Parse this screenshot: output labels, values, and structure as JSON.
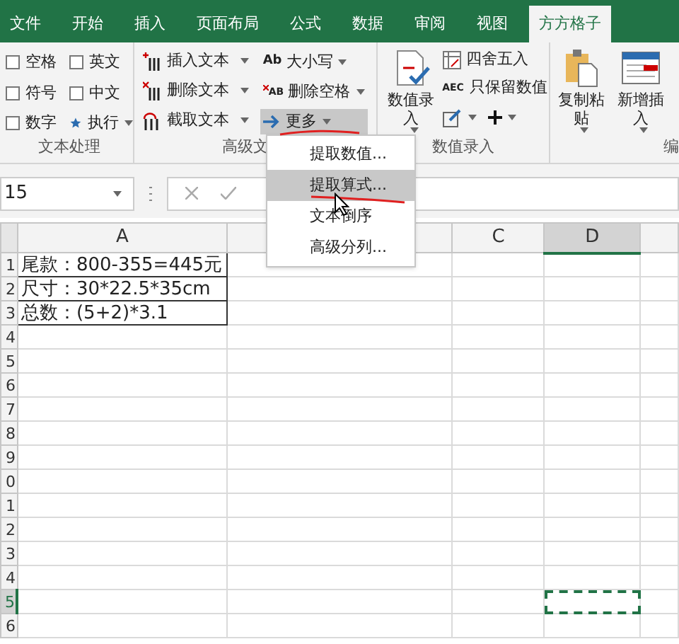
{
  "tabs": [
    {
      "label": "文件",
      "selected": false
    },
    {
      "label": "开始",
      "selected": false
    },
    {
      "label": "插入",
      "selected": false
    },
    {
      "label": "页面布局",
      "selected": false
    },
    {
      "label": "公式",
      "selected": false
    },
    {
      "label": "数据",
      "selected": false
    },
    {
      "label": "审阅",
      "selected": false
    },
    {
      "label": "视图",
      "selected": false
    },
    {
      "label": "方方格子",
      "selected": true
    }
  ],
  "text_group": {
    "label": "文本处理",
    "options": [
      {
        "label": "空格",
        "checked": false
      },
      {
        "label": "英文",
        "checked": false
      },
      {
        "label": "符号",
        "checked": false
      },
      {
        "label": "中文",
        "checked": false
      },
      {
        "label": "数字",
        "checked": false
      }
    ],
    "run_button": "执行"
  },
  "advanced_text": {
    "label": "高级文",
    "left_buttons": [
      "插入文本",
      "删除文本",
      "截取文本"
    ],
    "right_buttons": [
      {
        "label": "大小写",
        "icon_text": "Ab",
        "pressed": false
      },
      {
        "label": "删除空格",
        "icon_text": "AB",
        "pressed": false
      },
      {
        "label": "更多",
        "pressed": true
      }
    ]
  },
  "number_entry": {
    "label": "数值录入",
    "big_button": "数值录入",
    "buttons": [
      "四舍五入",
      "只保留数值"
    ],
    "icon_text": "AEC"
  },
  "edit_group": {
    "label": "编",
    "big_buttons": [
      "复制粘贴",
      "新增插入"
    ]
  },
  "name_box": "15",
  "menu": {
    "items": [
      {
        "label": "提取数值...",
        "selected": false
      },
      {
        "label": "提取算式...",
        "selected": true
      },
      {
        "label": "文本倒序",
        "selected": false
      },
      {
        "label": "高级分列...",
        "selected": false
      }
    ]
  },
  "sheet": {
    "columns": [
      {
        "label": "A",
        "selected": false
      },
      {
        "selected": false
      },
      {
        "label": "C",
        "selected": false
      },
      {
        "label": "D",
        "selected": true
      }
    ],
    "rows": [
      {
        "header": "1",
        "selected": false,
        "cells": [
          "尾款：800-355=445元"
        ]
      },
      {
        "header": "2",
        "selected": false,
        "cells": [
          "尺寸：30*22.5*35cm"
        ]
      },
      {
        "header": "3",
        "selected": false,
        "cells": [
          "总数：(5+2)*3.1"
        ]
      },
      {
        "header": "4",
        "selected": false,
        "cells": []
      },
      {
        "header": "5",
        "selected": false,
        "cells": []
      },
      {
        "header": "6",
        "selected": false,
        "cells": []
      },
      {
        "header": "7",
        "selected": false,
        "cells": []
      },
      {
        "header": "8",
        "selected": false,
        "cells": []
      },
      {
        "header": "9",
        "selected": false,
        "cells": []
      },
      {
        "header": "0",
        "selected": false,
        "cells": []
      },
      {
        "header": "1",
        "selected": false,
        "cells": []
      },
      {
        "header": "2",
        "selected": false,
        "cells": []
      },
      {
        "header": "3",
        "selected": false,
        "cells": []
      },
      {
        "header": "4",
        "selected": false,
        "cells": []
      },
      {
        "header": "5",
        "selected": true,
        "cells": []
      },
      {
        "header": "6",
        "selected": false,
        "cells": []
      }
    ]
  }
}
